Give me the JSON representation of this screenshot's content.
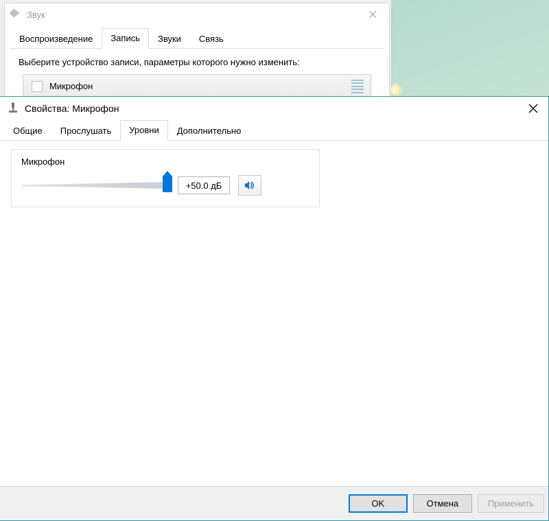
{
  "sound_window": {
    "title": "Звук",
    "tabs": [
      {
        "label": "Воспроизведение",
        "active": false
      },
      {
        "label": "Запись",
        "active": true
      },
      {
        "label": "Звуки",
        "active": false
      },
      {
        "label": "Связь",
        "active": false
      }
    ],
    "instruction": "Выберите устройство записи, параметры которого нужно изменить:",
    "device_name": "Микрофон"
  },
  "props_window": {
    "title": "Свойства: Микрофон",
    "tabs": [
      {
        "label": "Общие",
        "active": false
      },
      {
        "label": "Прослушать",
        "active": false
      },
      {
        "label": "Уровни",
        "active": true
      },
      {
        "label": "Дополнительно",
        "active": false
      }
    ],
    "levels": {
      "caption": "Микрофон",
      "db_value": "+50.0 дБ",
      "slider_percent": 100
    },
    "buttons": {
      "ok": "OK",
      "cancel": "Отмена",
      "apply": "Применить"
    }
  }
}
